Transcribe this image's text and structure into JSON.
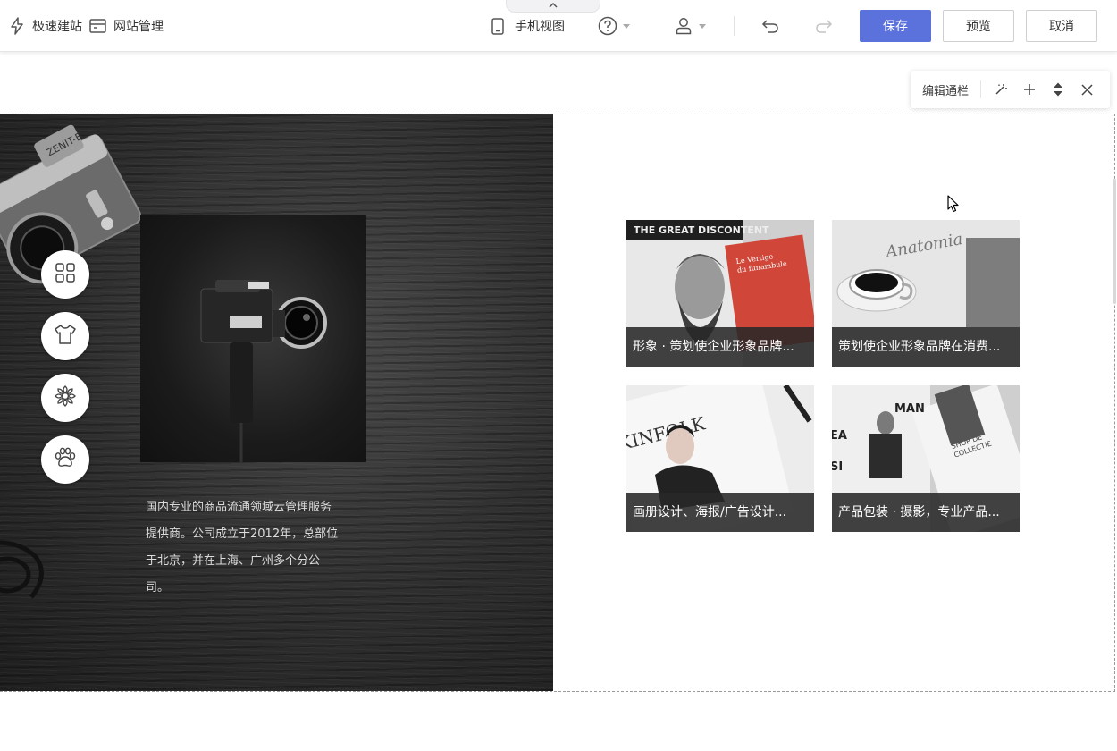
{
  "toolbar": {
    "quick_build": "极速建站",
    "site_manage": "网站管理",
    "mobile_view": "手机视图",
    "save": "保存",
    "preview": "预览",
    "cancel": "取消"
  },
  "editbar": {
    "title": "编辑通栏"
  },
  "section": {
    "description": "国内专业的商品流通领域云管理服务提供商。公司成立于2012年，总部位于北京，并在上海、广州多个分公司。",
    "cards": [
      {
        "caption": "形象 · 策划使企业形象品牌..."
      },
      {
        "caption": "策划使企业形象品牌在消费..."
      },
      {
        "caption": "画册设计、海报/广告设计..."
      },
      {
        "caption": "产品包装 · 摄影，专业产品..."
      }
    ]
  },
  "colors": {
    "primary": "#5b72dd",
    "dark_panel": "#2e2e2e",
    "caption_bg": "#282828"
  },
  "icons": [
    "flash-icon",
    "site-manage-icon",
    "phone-icon",
    "help-icon",
    "user-icon",
    "undo-icon",
    "redo-icon",
    "magic-icon",
    "plus-icon",
    "sort-icon",
    "close-icon",
    "grid-icon",
    "tshirt-icon",
    "flower-icon",
    "paw-icon"
  ]
}
